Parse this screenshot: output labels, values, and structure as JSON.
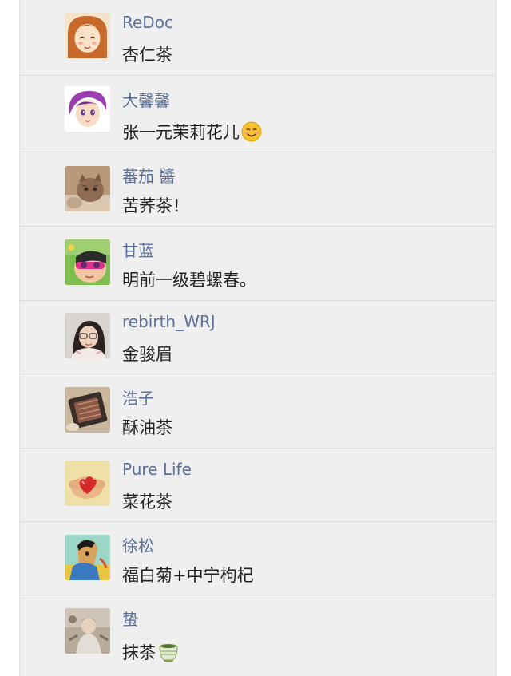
{
  "comments": [
    {
      "name": "ReDoc",
      "text": "杏仁茶"
    },
    {
      "name": "大馨馨",
      "text": "张一元茉莉花儿",
      "emoji": "smiling-face-emoji"
    },
    {
      "name": "蕃茄 醬",
      "text": "苦荞茶！"
    },
    {
      "name": "甘蓝",
      "text": "明前一级碧螺春。"
    },
    {
      "name": "rebirth_WRJ",
      "text": "金骏眉"
    },
    {
      "name": "浩子",
      "text": "酥油茶"
    },
    {
      "name": "Pure Life",
      "text": "菜花茶"
    },
    {
      "name": "徐松",
      "text": "福白菊+中宁枸杞"
    },
    {
      "name": "蛰",
      "text": "抹茶",
      "emoji": "green-tea-emoji"
    }
  ],
  "colors": {
    "name": "#5a6f99",
    "text": "#222222",
    "background": "#efeff0",
    "divider": "#dcdcde"
  }
}
